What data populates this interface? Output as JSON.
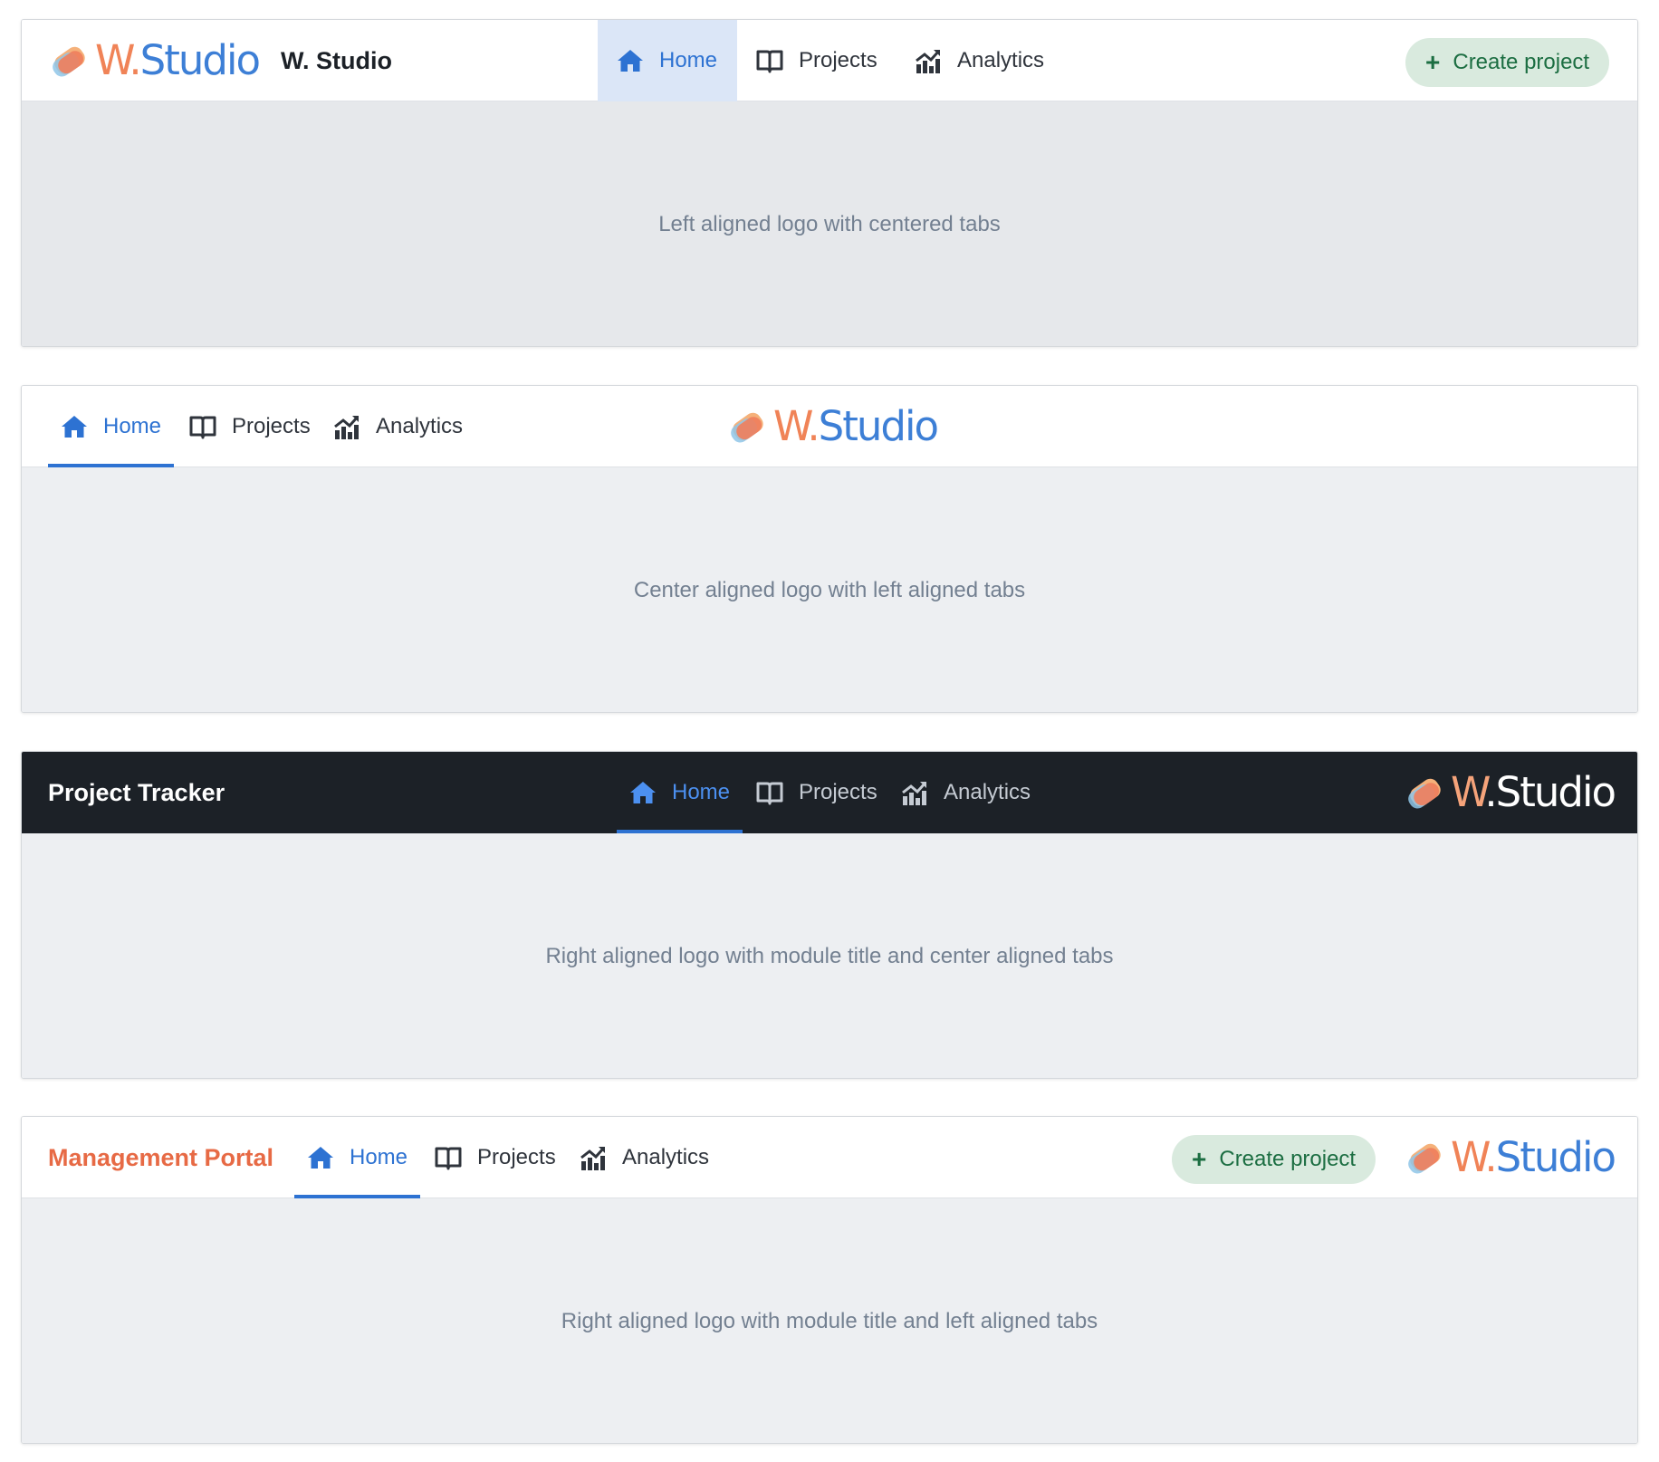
{
  "brand": {
    "wordmark_w": "W",
    "wordmark_dot": ".",
    "wordmark_studio": "Studio"
  },
  "tabs": [
    {
      "label": "Home",
      "icon": "home-icon"
    },
    {
      "label": "Projects",
      "icon": "book-icon"
    },
    {
      "label": "Analytics",
      "icon": "chart-icon"
    }
  ],
  "examples": [
    {
      "site_name": "W. Studio",
      "create_label": "Create project",
      "description": "Left aligned logo with centered tabs"
    },
    {
      "description": "Center aligned logo with left aligned tabs"
    },
    {
      "module_title": "Project Tracker",
      "description": "Right aligned logo with module title and center aligned tabs"
    },
    {
      "module_title": "Management Portal",
      "create_label": "Create project",
      "description": "Right aligned logo with module title and left aligned tabs"
    }
  ],
  "colors": {
    "accent": "#2d72d2",
    "dark_nav": "#1c2127",
    "create_bg": "#d9eade",
    "module_title_orange": "#e76a45"
  }
}
